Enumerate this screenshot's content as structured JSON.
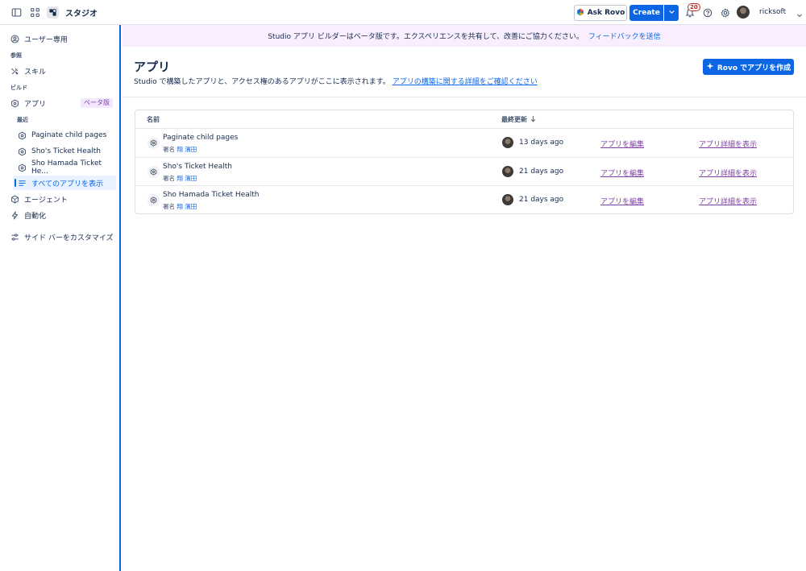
{
  "topbar": {
    "app_title": "スタジオ",
    "ask_rovo": "Ask Rovo",
    "create": "Create",
    "notification_count": "20",
    "username": "ricksoft"
  },
  "sidebar": {
    "personal": "ユーザー専用",
    "section_reference": "参照",
    "skills": "スキル",
    "section_build": "ビルド",
    "apps": "アプリ",
    "apps_badge": "ベータ版",
    "section_recent": "最近",
    "recent_items": [
      "Paginate child pages",
      "Sho's Ticket Health",
      "Sho Hamada Ticket He..."
    ],
    "view_all_apps": "すべてのアプリを表示",
    "agents": "エージェント",
    "automation": "自動化",
    "customize": "サイド バーをカスタマイズ"
  },
  "banner": {
    "text": "Studio アプリ ビルダーはベータ版です。エクスペリエンスを共有して、改善にご協力ください。",
    "link": "フィードバックを送信"
  },
  "main": {
    "title": "アプリ",
    "description": "Studio で構築したアプリと、アクセス権のあるアプリがここに表示されます。",
    "description_link": "アプリの構築に関する詳細をご確認ください",
    "create_button": "Rovo でアプリを作成"
  },
  "table": {
    "col_name": "名前",
    "col_updated": "最終更新",
    "rows": [
      {
        "name": "Paginate child pages",
        "author_label": "署名",
        "author": "翔 濱田",
        "updated": "13 days ago",
        "edit": "アプリを編集",
        "details": "アプリ詳細を表示"
      },
      {
        "name": "Sho's Ticket Health",
        "author_label": "署名",
        "author": "翔 濱田",
        "updated": "21 days ago",
        "edit": "アプリを編集",
        "details": "アプリ詳細を表示"
      },
      {
        "name": "Sho Hamada Ticket Health",
        "author_label": "署名",
        "author": "翔 濱田",
        "updated": "21 days ago",
        "edit": "アプリを編集",
        "details": "アプリ詳細を表示"
      }
    ]
  },
  "colors": {
    "accent": "#0c66e4",
    "banner_bg": "#f8eefe",
    "visited_link": "#803fa5",
    "beta_badge_bg": "#f3e8fd"
  },
  "icons": [
    "sidebar-toggle-icon",
    "app-switcher-icon",
    "studio-logo-icon",
    "rovo-icon",
    "chevron-down-icon",
    "bell-icon",
    "help-icon",
    "gear-icon",
    "user-circle-icon",
    "skills-icon",
    "app-hex-icon",
    "agent-icon",
    "lightning-icon",
    "sliders-icon",
    "list-icon",
    "sparkle-icon",
    "arrow-down-icon"
  ]
}
